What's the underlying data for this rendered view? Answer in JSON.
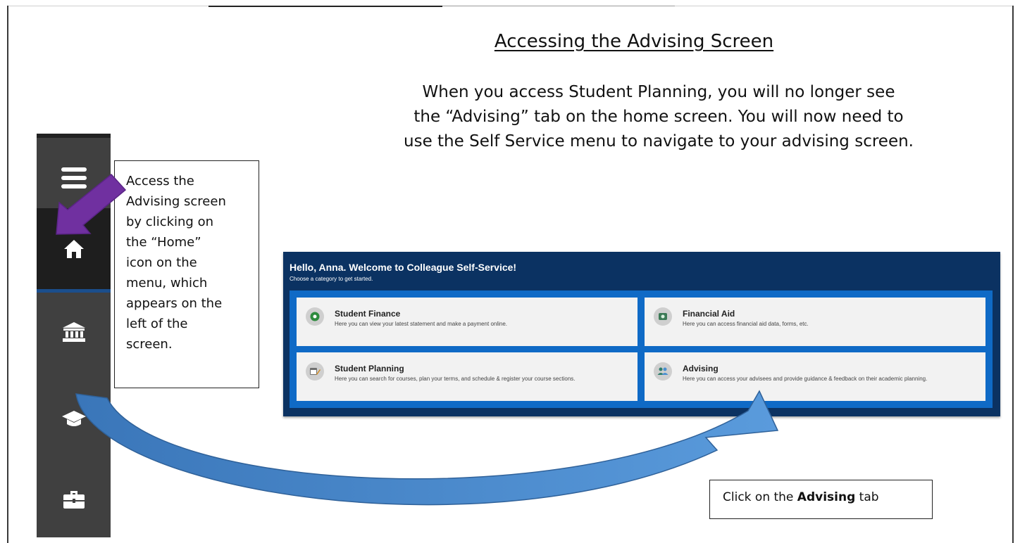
{
  "document": {
    "title": "Accessing the Advising Screen",
    "intro_lines": [
      "When you access Student Planning, you will no longer see",
      "the “Advising” tab on the home screen.  You will now need to",
      "use the Self Service menu to navigate to your advising screen."
    ]
  },
  "callout": {
    "lines": [
      "Access the",
      "Advising screen",
      "by clicking on",
      "the “Home”",
      "icon on the",
      "menu, which",
      "appears on the",
      "left of the",
      "screen."
    ]
  },
  "side_menu": {
    "icons": [
      "hamburger-icon",
      "home-icon",
      "bank-icon",
      "graduation-cap-icon",
      "briefcase-icon"
    ]
  },
  "panel": {
    "heading": "Hello, Anna. Welcome to Colleague Self-Service!",
    "subheading": "Choose a category to get started.",
    "tiles": [
      {
        "title": "Student Finance",
        "description": "Here you can view your latest statement and make a payment online.",
        "icon": "dollar-icon"
      },
      {
        "title": "Financial Aid",
        "description": "Here you can access financial aid data, forms, etc.",
        "icon": "money-icon"
      },
      {
        "title": "Student Planning",
        "description": "Here you can search for courses, plan your terms, and schedule & register your course sections.",
        "icon": "calendar-icon"
      },
      {
        "title": "Advising",
        "description": "Here you can access your advisees and provide guidance & feedback on their academic planning.",
        "icon": "people-icon"
      }
    ]
  },
  "click_note": {
    "prefix": "Click on the ",
    "bold": "Advising",
    "suffix": " tab"
  },
  "colors": {
    "panel_navy": "#0b3262",
    "panel_blue": "#0f6ac6",
    "menu_gray": "#404040",
    "purple_arrow": "#7030a0",
    "blue_arrow": "#4a86c8"
  }
}
